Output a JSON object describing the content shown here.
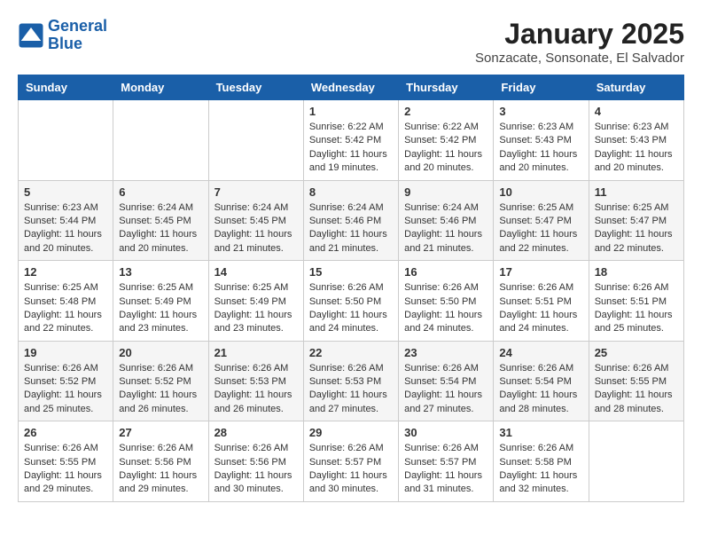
{
  "header": {
    "logo_line1": "General",
    "logo_line2": "Blue",
    "title": "January 2025",
    "subtitle": "Sonzacate, Sonsonate, El Salvador"
  },
  "days_of_week": [
    "Sunday",
    "Monday",
    "Tuesday",
    "Wednesday",
    "Thursday",
    "Friday",
    "Saturday"
  ],
  "weeks": [
    [
      {
        "day": "",
        "info": ""
      },
      {
        "day": "",
        "info": ""
      },
      {
        "day": "",
        "info": ""
      },
      {
        "day": "1",
        "info": "Sunrise: 6:22 AM\nSunset: 5:42 PM\nDaylight: 11 hours and 19 minutes."
      },
      {
        "day": "2",
        "info": "Sunrise: 6:22 AM\nSunset: 5:42 PM\nDaylight: 11 hours and 20 minutes."
      },
      {
        "day": "3",
        "info": "Sunrise: 6:23 AM\nSunset: 5:43 PM\nDaylight: 11 hours and 20 minutes."
      },
      {
        "day": "4",
        "info": "Sunrise: 6:23 AM\nSunset: 5:43 PM\nDaylight: 11 hours and 20 minutes."
      }
    ],
    [
      {
        "day": "5",
        "info": "Sunrise: 6:23 AM\nSunset: 5:44 PM\nDaylight: 11 hours and 20 minutes."
      },
      {
        "day": "6",
        "info": "Sunrise: 6:24 AM\nSunset: 5:45 PM\nDaylight: 11 hours and 20 minutes."
      },
      {
        "day": "7",
        "info": "Sunrise: 6:24 AM\nSunset: 5:45 PM\nDaylight: 11 hours and 21 minutes."
      },
      {
        "day": "8",
        "info": "Sunrise: 6:24 AM\nSunset: 5:46 PM\nDaylight: 11 hours and 21 minutes."
      },
      {
        "day": "9",
        "info": "Sunrise: 6:24 AM\nSunset: 5:46 PM\nDaylight: 11 hours and 21 minutes."
      },
      {
        "day": "10",
        "info": "Sunrise: 6:25 AM\nSunset: 5:47 PM\nDaylight: 11 hours and 22 minutes."
      },
      {
        "day": "11",
        "info": "Sunrise: 6:25 AM\nSunset: 5:47 PM\nDaylight: 11 hours and 22 minutes."
      }
    ],
    [
      {
        "day": "12",
        "info": "Sunrise: 6:25 AM\nSunset: 5:48 PM\nDaylight: 11 hours and 22 minutes."
      },
      {
        "day": "13",
        "info": "Sunrise: 6:25 AM\nSunset: 5:49 PM\nDaylight: 11 hours and 23 minutes."
      },
      {
        "day": "14",
        "info": "Sunrise: 6:25 AM\nSunset: 5:49 PM\nDaylight: 11 hours and 23 minutes."
      },
      {
        "day": "15",
        "info": "Sunrise: 6:26 AM\nSunset: 5:50 PM\nDaylight: 11 hours and 24 minutes."
      },
      {
        "day": "16",
        "info": "Sunrise: 6:26 AM\nSunset: 5:50 PM\nDaylight: 11 hours and 24 minutes."
      },
      {
        "day": "17",
        "info": "Sunrise: 6:26 AM\nSunset: 5:51 PM\nDaylight: 11 hours and 24 minutes."
      },
      {
        "day": "18",
        "info": "Sunrise: 6:26 AM\nSunset: 5:51 PM\nDaylight: 11 hours and 25 minutes."
      }
    ],
    [
      {
        "day": "19",
        "info": "Sunrise: 6:26 AM\nSunset: 5:52 PM\nDaylight: 11 hours and 25 minutes."
      },
      {
        "day": "20",
        "info": "Sunrise: 6:26 AM\nSunset: 5:52 PM\nDaylight: 11 hours and 26 minutes."
      },
      {
        "day": "21",
        "info": "Sunrise: 6:26 AM\nSunset: 5:53 PM\nDaylight: 11 hours and 26 minutes."
      },
      {
        "day": "22",
        "info": "Sunrise: 6:26 AM\nSunset: 5:53 PM\nDaylight: 11 hours and 27 minutes."
      },
      {
        "day": "23",
        "info": "Sunrise: 6:26 AM\nSunset: 5:54 PM\nDaylight: 11 hours and 27 minutes."
      },
      {
        "day": "24",
        "info": "Sunrise: 6:26 AM\nSunset: 5:54 PM\nDaylight: 11 hours and 28 minutes."
      },
      {
        "day": "25",
        "info": "Sunrise: 6:26 AM\nSunset: 5:55 PM\nDaylight: 11 hours and 28 minutes."
      }
    ],
    [
      {
        "day": "26",
        "info": "Sunrise: 6:26 AM\nSunset: 5:55 PM\nDaylight: 11 hours and 29 minutes."
      },
      {
        "day": "27",
        "info": "Sunrise: 6:26 AM\nSunset: 5:56 PM\nDaylight: 11 hours and 29 minutes."
      },
      {
        "day": "28",
        "info": "Sunrise: 6:26 AM\nSunset: 5:56 PM\nDaylight: 11 hours and 30 minutes."
      },
      {
        "day": "29",
        "info": "Sunrise: 6:26 AM\nSunset: 5:57 PM\nDaylight: 11 hours and 30 minutes."
      },
      {
        "day": "30",
        "info": "Sunrise: 6:26 AM\nSunset: 5:57 PM\nDaylight: 11 hours and 31 minutes."
      },
      {
        "day": "31",
        "info": "Sunrise: 6:26 AM\nSunset: 5:58 PM\nDaylight: 11 hours and 32 minutes."
      },
      {
        "day": "",
        "info": ""
      }
    ]
  ]
}
